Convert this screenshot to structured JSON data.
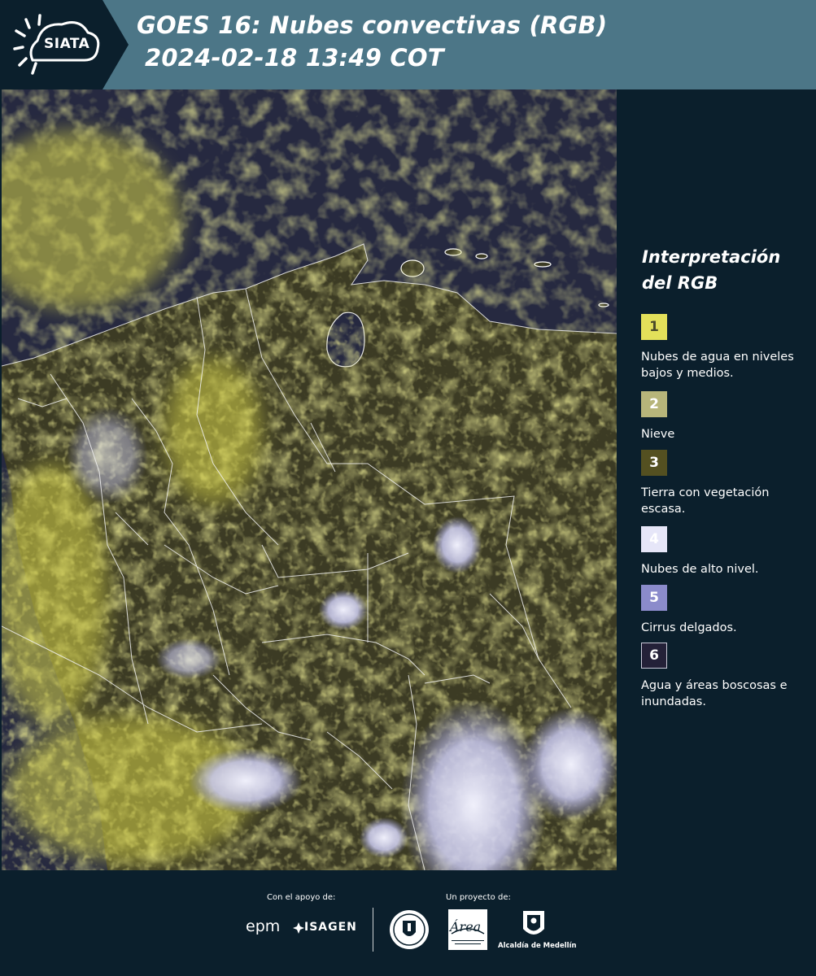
{
  "header": {
    "logo": "SIATA",
    "title_line1": "GOES 16: Nubes convectivas (RGB)",
    "title_line2": "2024-02-18 13:49 COT"
  },
  "legend": {
    "title": "Interpretación del RGB",
    "items": [
      {
        "number": "1",
        "label": "Nubes de agua en niveles bajos y medios.",
        "color": "#e3e05a",
        "text_color": "#4a4a2a"
      },
      {
        "number": "2",
        "label": "Nieve",
        "color": "#b7b57a",
        "text_color": "#ffffff"
      },
      {
        "number": "3",
        "label": "Tierra con vegetación escasa.",
        "color": "#545021",
        "text_color": "#ffffff"
      },
      {
        "number": "4",
        "label": "Nubes de alto nivel.",
        "color": "#e6e6f8",
        "text_color": "#ffffff"
      },
      {
        "number": "5",
        "label": "Cirrus delgados.",
        "color": "#8b8bcb",
        "text_color": "#ffffff"
      },
      {
        "number": "6",
        "label": "Agua y áreas boscosas e inundadas.",
        "color": "#242138",
        "text_color": "#ffffff"
      }
    ]
  },
  "footer": {
    "support_label": "Con el apoyo de:",
    "project_label": "Un proyecto de:",
    "sponsors": [
      "epm",
      "ISAGEN"
    ],
    "area_logo": "Área",
    "area_subtitle": "METROPOLITANA Valle de Aburrá",
    "alcaldia": "Alcaldía de Medellín"
  },
  "colors": {
    "header_bg": "#4c7687",
    "panel_bg": "#0b1f2c",
    "ocean": "#262940",
    "land": "#3c3b24",
    "low_clouds": "#d9d64f",
    "high_clouds": "#e3e3f7"
  }
}
